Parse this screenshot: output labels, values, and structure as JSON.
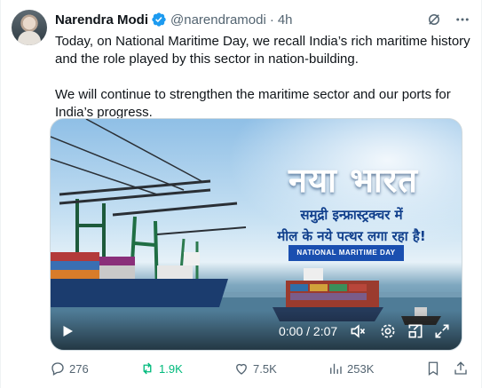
{
  "author": {
    "name": "Narendra Modi",
    "handle": "@narendramodi",
    "separator": "·",
    "time": "4h",
    "verified_color": "#1d9bf0"
  },
  "header_icons": [
    "grok-icon",
    "more-icon"
  ],
  "tweet": {
    "paragraph1": "Today, on National Maritime Day, we recall India’s rich maritime history and the role played by this sector in nation-building.",
    "paragraph2": "We will continue to strengthen the maritime sector and our ports for India’s progress."
  },
  "media": {
    "title": "नया भारत",
    "subtitle_line1": "समुद्री इन्फ्रास्ट्रक्चर में",
    "subtitle_line2": "मील के नये पत्थर लगा रहा है!",
    "badge": "NATIONAL MARITIME DAY",
    "video_time": "0:00 / 2:07",
    "controls": [
      "play-icon",
      "volume-icon",
      "settings-icon",
      "popout-icon",
      "fullscreen-icon"
    ]
  },
  "actions": {
    "replies": "276",
    "reposts": "1.9K",
    "likes": "7.5K",
    "views": "253K",
    "accent_repost": "#00ba7c"
  }
}
